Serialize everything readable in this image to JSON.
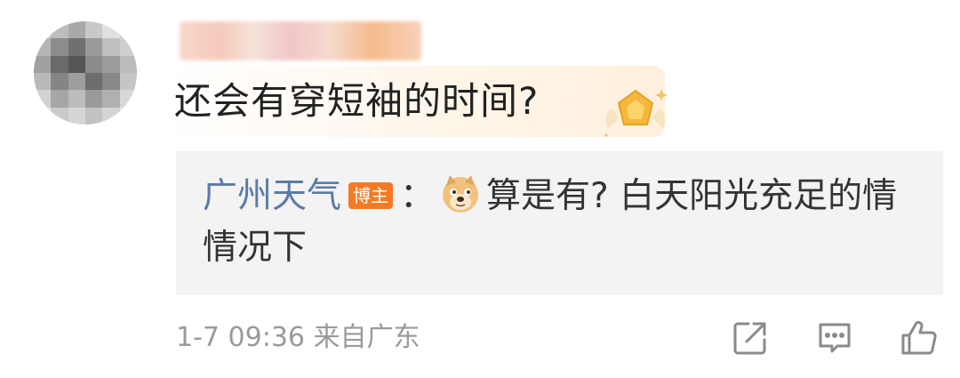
{
  "comment": {
    "text": "还会有穿短袖的时间?"
  },
  "reply": {
    "author": "广州天气",
    "author_tag": "博主",
    "separator": "：",
    "emoji": "doge-emoji",
    "text": "算是有? 白天阳光充足的情情况下"
  },
  "meta": {
    "timestamp": "1-7 09:36",
    "location": "来自广东"
  },
  "icons": {
    "share": "share-icon",
    "comment": "comment-icon",
    "like": "thumbs-up-icon"
  },
  "colors": {
    "author_link": "#5b7ba8",
    "tag_bg": "#f57a23",
    "reply_bg": "#f3f3f3",
    "meta_text": "#9a9a9a"
  }
}
